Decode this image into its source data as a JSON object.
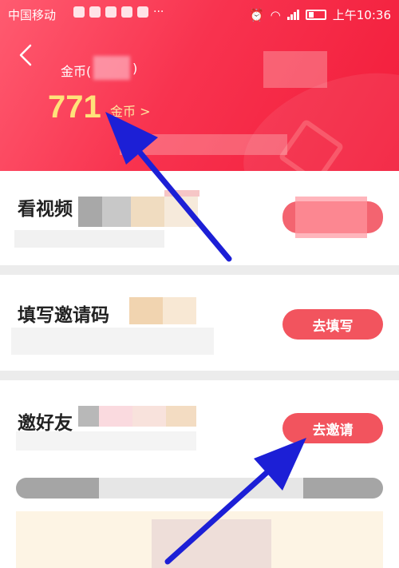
{
  "statusbar": {
    "carrier": "中国移动",
    "time": "上午10:36"
  },
  "header": {
    "coin_label": "金币(",
    "coin_paren": ")",
    "coin_value": "771",
    "coin_unit": "金币 >"
  },
  "tasks": [
    {
      "title": "看视频",
      "button": ""
    },
    {
      "title": "填写邀请码",
      "button": "去填写"
    },
    {
      "title": "邀好友",
      "button": "去邀请"
    }
  ],
  "colors": {
    "header_red": "#f8334f",
    "button_red": "#f2545e",
    "coin_yellow": "#ffe27a",
    "arrow_blue": "#1c1fd6"
  }
}
